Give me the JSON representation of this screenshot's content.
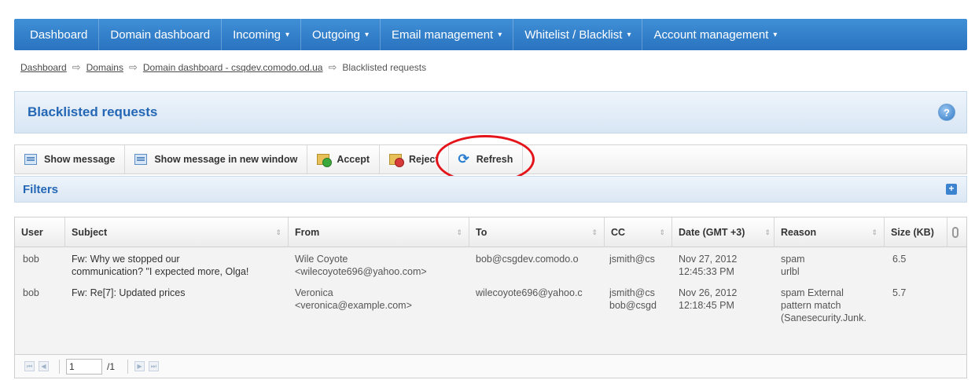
{
  "nav": {
    "items": [
      {
        "label": "Dashboard",
        "caret": ""
      },
      {
        "label": "Domain dashboard",
        "caret": ""
      },
      {
        "label": "Incoming",
        "caret": "▾"
      },
      {
        "label": "Outgoing",
        "caret": "▾"
      },
      {
        "label": "Email management",
        "caret": "▾"
      },
      {
        "label": "Whitelist / Blacklist",
        "caret": "▾"
      },
      {
        "label": "Account management",
        "caret": "▾"
      }
    ]
  },
  "breadcrumb": {
    "items": [
      "Dashboard",
      "Domains",
      "Domain dashboard - csqdev.comodo.od.ua"
    ],
    "current": "Blacklisted requests",
    "separator": "⇨"
  },
  "page": {
    "title": "Blacklisted requests",
    "help_icon": "?"
  },
  "toolbar": {
    "show_message": "Show message",
    "show_message_new_window": "Show message in new window",
    "accept": "Accept",
    "reject": "Reject",
    "refresh": "Refresh",
    "refresh_icon": "⟳"
  },
  "filters": {
    "label": "Filters",
    "expand_icon": "+"
  },
  "table": {
    "columns": {
      "user": "User",
      "subject": "Subject",
      "from": "From",
      "to": "To",
      "cc": "CC",
      "date": "Date (GMT +3)",
      "reason": "Reason",
      "size": "Size (KB)"
    },
    "sort_icon": "⇕",
    "rows": [
      {
        "user": "bob",
        "subject_line1": "Fw: Why we stopped our",
        "subject_line2": "communication? \"I expected more, Olga!",
        "from_line1": "Wile Coyote",
        "from_line2": "<wilecoyote696@yahoo.com>",
        "to": "bob@csgdev.comodo.o",
        "cc_line1": "jsmith@cs",
        "cc_line2": "",
        "date_line1": "Nov 27, 2012",
        "date_line2": "12:45:33 PM",
        "reason": "spam urlbl",
        "size": "6.5"
      },
      {
        "user": "bob",
        "subject_line1": "Fw: Re[7]: Updated prices",
        "subject_line2": "",
        "from_line1": "Veronica",
        "from_line2": "<veronica@example.com>",
        "to": "wilecoyote696@yahoo.c",
        "cc_line1": "jsmith@cs",
        "cc_line2": "bob@csgd",
        "date_line1": "Nov 26, 2012",
        "date_line2": "12:18:45 PM",
        "reason": "spam External pattern match (Sanesecurity.Junk.",
        "size": "5.7"
      }
    ]
  },
  "pager": {
    "current_page": "1",
    "total": "/1",
    "first": "⏮",
    "prev": "◀",
    "next": "▶",
    "last": "⏭"
  },
  "colors": {
    "nav": "#2a73c0",
    "accent": "#2467b5",
    "highlight": "#e4141b"
  }
}
